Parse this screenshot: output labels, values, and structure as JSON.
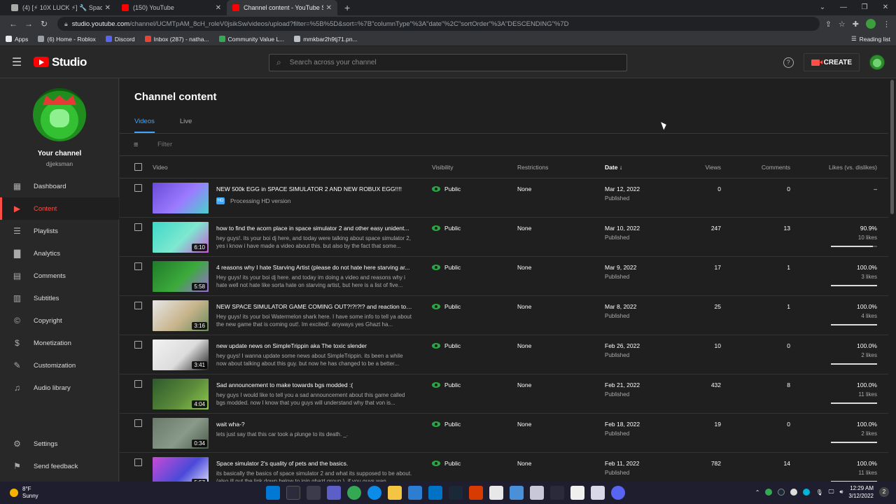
{
  "browser": {
    "tabs": [
      {
        "title": "(4) [⚡ 10X LUCK ⚡] 🔧 Space Si",
        "color": "#aaaaaa",
        "active": false
      },
      {
        "title": "(150) YouTube",
        "color": "#ff0000",
        "active": false
      },
      {
        "title": "Channel content - YouTube Studi",
        "color": "#ff0000",
        "active": true
      }
    ],
    "url_host": "studio.youtube.com",
    "url_path": "/channel/UCMTpAM_8cH_roleV0jsikSw/videos/upload?filter=%5B%5D&sort=%7B\"columnType\"%3A\"date\"%2C\"sortOrder\"%3A\"DESCENDING\"%7D",
    "bookmarks": [
      {
        "label": "Apps",
        "color": "#e8eaed"
      },
      {
        "label": "(6) Home - Roblox",
        "color": "#9aa0a6"
      },
      {
        "label": "Discord",
        "color": "#5865f2"
      },
      {
        "label": "Inbox (287) - natha...",
        "color": "#ea4335"
      },
      {
        "label": "Community Value L...",
        "color": "#34a853"
      },
      {
        "label": "mmkbar2h9tj71.pn...",
        "color": "#bdc1c6"
      }
    ],
    "reading_list": "Reading list"
  },
  "header": {
    "logo_text": "Studio",
    "search_placeholder": "Search across your channel",
    "create_label": "CREATE",
    "help": "?"
  },
  "sidebar": {
    "channel_label": "Your channel",
    "handle": "djjeksman",
    "items": [
      {
        "label": "Dashboard",
        "icon": "dashboard-icon",
        "glyph": "▦"
      },
      {
        "label": "Content",
        "icon": "content-icon",
        "glyph": "▶",
        "active": true
      },
      {
        "label": "Playlists",
        "icon": "playlists-icon",
        "glyph": "☰"
      },
      {
        "label": "Analytics",
        "icon": "analytics-icon",
        "glyph": "▇"
      },
      {
        "label": "Comments",
        "icon": "comments-icon",
        "glyph": "▤"
      },
      {
        "label": "Subtitles",
        "icon": "subtitles-icon",
        "glyph": "▥"
      },
      {
        "label": "Copyright",
        "icon": "copyright-icon",
        "glyph": "©"
      },
      {
        "label": "Monetization",
        "icon": "monetization-icon",
        "glyph": "$"
      },
      {
        "label": "Customization",
        "icon": "customization-icon",
        "glyph": "✎"
      },
      {
        "label": "Audio library",
        "icon": "audio-library-icon",
        "glyph": "♫"
      }
    ],
    "bottom_items": [
      {
        "label": "Settings",
        "icon": "settings-icon",
        "glyph": "⚙"
      },
      {
        "label": "Send feedback",
        "icon": "feedback-icon",
        "glyph": "⚑"
      }
    ]
  },
  "main": {
    "title": "Channel content",
    "tabs": [
      {
        "label": "Videos",
        "active": true
      },
      {
        "label": "Live",
        "active": false
      }
    ],
    "filter_placeholder": "Filter",
    "columns": {
      "video": "Video",
      "visibility": "Visibility",
      "restrictions": "Restrictions",
      "date": "Date",
      "views": "Views",
      "comments": "Comments",
      "likes": "Likes (vs. dislikes)"
    },
    "videos": [
      {
        "title": "NEW 500k EGG in SPACE SIMULATOR 2 AND NEW ROBUX EGG!!!!",
        "desc": "",
        "processing": "Processing HD version",
        "duration": "",
        "visibility": "Public",
        "restrictions": "None",
        "date": "Mar 12, 2022",
        "status": "Published",
        "views": "0",
        "comments": "0",
        "likes": "–",
        "likes_sub": "",
        "like_ratio": null,
        "thumb": [
          "#6a4bd8",
          "#9b7cff",
          "#48d1cc"
        ]
      },
      {
        "title": "how to find the acorn place in space simulator 2 and other easy unident...",
        "desc": "hey guys!. its your boi dj here, and today were talking about space simulator 2, yes i know i have made a video about this. but also by the fact that some...",
        "processing": "",
        "duration": "6:10",
        "visibility": "Public",
        "restrictions": "None",
        "date": "Mar 10, 2022",
        "status": "Published",
        "views": "247",
        "comments": "13",
        "likes": "90.9%",
        "likes_sub": "10 likes",
        "like_ratio": 0.909,
        "thumb": [
          "#3fd8c8",
          "#7ee8d0",
          "#c85ad8"
        ]
      },
      {
        "title": "4 reasons why I hate Starving Artist (please do not hate here starving ar...",
        "desc": "Hey guys! its your boi dj here. and today im doing a video and reasons why i hate well not hate like sorta hate on starving artist, but here is a list of five...",
        "processing": "",
        "duration": "5:58",
        "visibility": "Public",
        "restrictions": "None",
        "date": "Mar 9, 2022",
        "status": "Published",
        "views": "17",
        "comments": "1",
        "likes": "100.0%",
        "likes_sub": "3 likes",
        "like_ratio": 1.0,
        "thumb": [
          "#1f7a2a",
          "#3caa3c",
          "#9a6bd8"
        ]
      },
      {
        "title": "NEW SPACE SIMULATOR GAME COMING OUT?!?!?!? and reaction towar...",
        "desc": "Hey guys! its your boi Watermelon shark here. I have some info to tell ya about the new game that is coming out!. Im excited!. anyways yes Ghazt ha...",
        "processing": "",
        "duration": "3:16",
        "visibility": "Public",
        "restrictions": "None",
        "date": "Mar 8, 2022",
        "status": "Published",
        "views": "25",
        "comments": "1",
        "likes": "100.0%",
        "likes_sub": "4 likes",
        "like_ratio": 1.0,
        "thumb": [
          "#e6e6e6",
          "#c8b48c",
          "#6a8a5a"
        ]
      },
      {
        "title": "new update news on SimpleTrippin aka The toxic slender",
        "desc": "hey guys! I wanna update some news about SimpleTrippin. its been a while now about talking about this guy. but now he has changed to be a better...",
        "processing": "",
        "duration": "3:41",
        "visibility": "Public",
        "restrictions": "None",
        "date": "Feb 26, 2022",
        "status": "Published",
        "views": "10",
        "comments": "0",
        "likes": "100.0%",
        "likes_sub": "2 likes",
        "like_ratio": 1.0,
        "thumb": [
          "#f2f2f2",
          "#dcdcdc",
          "#222222"
        ]
      },
      {
        "title": "Sad announcement to make towards bgs modded :(",
        "desc": "hey guys I would like to tell you a sad announcement about this game called bgs modded. now I know that you guys will understand why that von is...",
        "processing": "",
        "duration": "4:04",
        "visibility": "Public",
        "restrictions": "None",
        "date": "Feb 21, 2022",
        "status": "Published",
        "views": "432",
        "comments": "8",
        "likes": "100.0%",
        "likes_sub": "11 likes",
        "like_ratio": 1.0,
        "thumb": [
          "#2d5a2d",
          "#5a8a3a",
          "#8cc84c"
        ]
      },
      {
        "title": "wait wha-?",
        "desc": "lets just say that this car took a plunge to its death. _.",
        "processing": "",
        "duration": "0:34",
        "visibility": "Public",
        "restrictions": "None",
        "date": "Feb 18, 2022",
        "status": "Published",
        "views": "19",
        "comments": "0",
        "likes": "100.0%",
        "likes_sub": "2 likes",
        "like_ratio": 1.0,
        "thumb": [
          "#6a7a6a",
          "#8a9a8a",
          "#4a5a4a"
        ]
      },
      {
        "title": "Space simulator 2's quality of pets and the basics.",
        "desc": "its basically the basics of space simulator 2 and what its supposed to be about. (also ill put the link down below to join ghazt group.). if you guys wan...",
        "processing": "",
        "duration": "5:57",
        "visibility": "Public",
        "restrictions": "None",
        "date": "Feb 11, 2022",
        "status": "Published",
        "views": "782",
        "comments": "14",
        "likes": "100.0%",
        "likes_sub": "11 likes",
        "like_ratio": 1.0,
        "thumb": [
          "#c84ad8",
          "#4a4ad8",
          "#e8e8ff"
        ]
      }
    ]
  },
  "taskbar": {
    "temp": "8°F",
    "weather": "Sunny",
    "time": "12:29 AM",
    "date": "3/12/2022",
    "notif": "2"
  }
}
